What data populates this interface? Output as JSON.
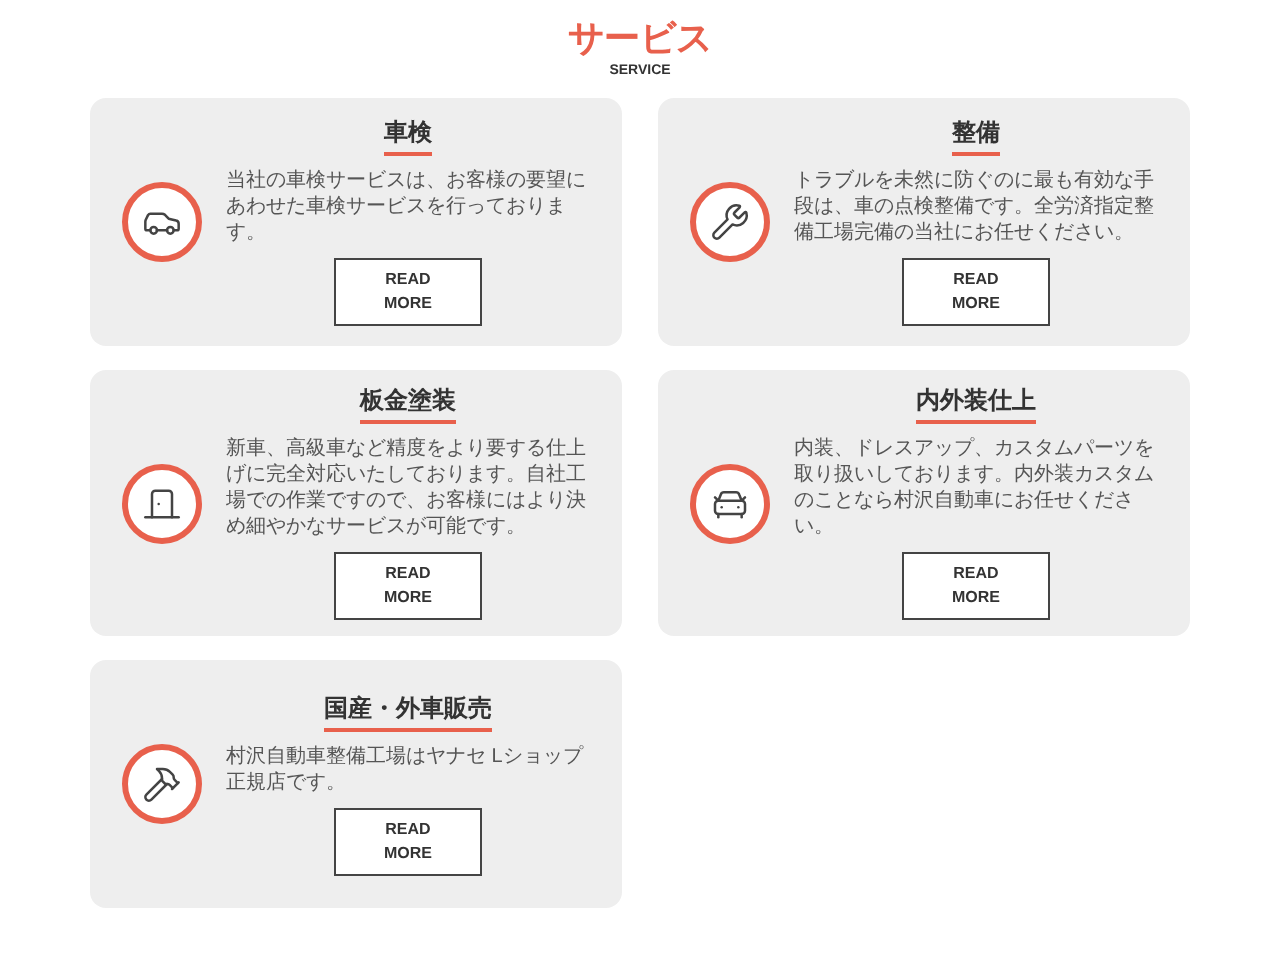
{
  "header": {
    "title": "サービス",
    "subtitle": "SERVICE"
  },
  "services": [
    {
      "title": "車検",
      "text": "当社の車検サービスは、お客様の要望にあわせた車検サービスを行っております。",
      "button": "READ MORE"
    },
    {
      "title": "整備",
      "text": "トラブルを未然に防ぐのに最も有効な手段は、車の点検整備です。全労済指定整備工場完備の当社にお任せください。",
      "button": "READ MORE"
    },
    {
      "title": "板金塗装",
      "text": "新車、高級車など精度をより要する仕上げに完全対応いたしております。自社工場での作業ですので、お客様にはより決め細やかなサービスが可能です。",
      "button": "READ MORE"
    },
    {
      "title": "内外装仕上",
      "text": "内装、ドレスアップ、カスタムパーツを取り扱いしております。内外装カスタムのことなら村沢自動車にお任せください。",
      "button": "READ MORE"
    },
    {
      "title": "国産・外車販売",
      "text": "村沢自動車整備工場はヤナセ Lショップ正規店です。",
      "button": "READ MORE"
    }
  ]
}
